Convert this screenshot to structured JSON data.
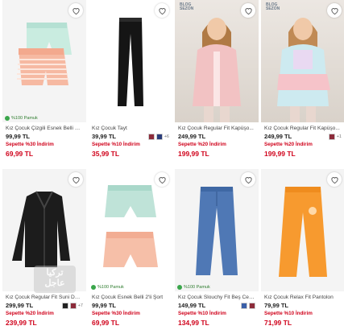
{
  "products": [
    {
      "title": "Kız Çocuk Çizgili Esnek Belli 2'li...",
      "price": "99,99 TL",
      "promo": "Sepette %30 İndirim",
      "final": "69,99 TL",
      "badge": "%100 Pamuk",
      "colors": [],
      "more": ""
    },
    {
      "title": "Kız Çocuk Tayt",
      "price": "39,99 TL",
      "promo": "Sepette %10 İndirim",
      "final": "35,99 TL",
      "badge": "",
      "colors": [
        "#8c2b3a",
        "#2b3d7a"
      ],
      "more": "+6"
    },
    {
      "title": "Kız Çocuk Regular Fit Kapüşo...",
      "price": "249,99 TL",
      "promo": "Sepette %20 İndirim",
      "final": "199,99 TL",
      "badge": "",
      "colors": [],
      "more": "",
      "tag": "BLOG\nSEZON"
    },
    {
      "title": "Kız Çocuk Regular Fit Kapüşo...",
      "price": "249,99 TL",
      "promo": "Sepette %20 İndirim",
      "final": "199,99 TL",
      "badge": "",
      "colors": [
        "#8c2b3a",
        "#2b3d7a"
      ],
      "more": "+1",
      "tag": "BLOG\nSEZON"
    },
    {
      "title": "Kız Çocuk Regular Fit Suni Der...",
      "price": "299,99 TL",
      "promo": "Sepette %20 İndirim",
      "final": "239,99 TL",
      "badge": "",
      "colors": [
        "#222",
        "#8c2b3a"
      ],
      "more": "+7"
    },
    {
      "title": "Kız Çocuk Esnek Belli 2'li Şort",
      "price": "99,99 TL",
      "promo": "Sepette %30 İndirim",
      "final": "69,99 TL",
      "badge": "%100 Pamuk",
      "colors": [],
      "more": ""
    },
    {
      "title": "Kız Çocuk Slouchy Fit Beş Cep...",
      "price": "149,99 TL",
      "promo": "Sepette %10 İndirim",
      "final": "134,99 TL",
      "badge": "%100 Pamuk",
      "colors": [
        "#3a5fa8",
        "#8c2b3a"
      ],
      "more": ""
    },
    {
      "title": "Kız Çocuk Relax Fit Pantolon",
      "price": "79,99 TL",
      "promo": "Sepette %10 İndirim",
      "final": "71,99 TL",
      "badge": "",
      "colors": [],
      "more": ""
    }
  ],
  "watermark": {
    "line1": "تركيا",
    "line2": "عاجل"
  },
  "colors": {
    "promo": "#d0021b",
    "cotton": "#3aa64b"
  }
}
